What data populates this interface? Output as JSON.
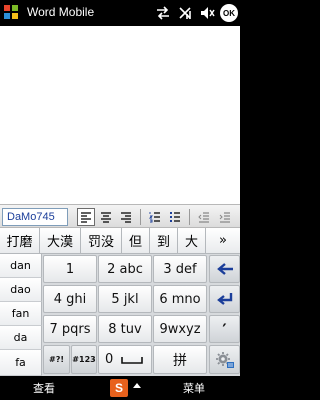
{
  "titlebar": {
    "title": "Word Mobile",
    "status_icons": [
      "connectivity-arrows-icon",
      "no-signal-icon",
      "speaker-muted-icon"
    ],
    "ok_label": "OK"
  },
  "toolbar": {
    "font_name": "DaMo745",
    "buttons": [
      "align-left-icon",
      "align-center-icon",
      "align-right-icon",
      "numbered-list-icon",
      "bulleted-list-icon",
      "decrease-indent-icon",
      "increase-indent-icon"
    ]
  },
  "keyboard": {
    "candidates": [
      "打磨",
      "大漠",
      "罚没",
      "但",
      "到",
      "大"
    ],
    "more_label": "»",
    "pinyin_options": [
      "dan",
      "dao",
      "fan",
      "da",
      "fa"
    ],
    "digit_keys": [
      {
        "label": "1"
      },
      {
        "label": "2 abc"
      },
      {
        "label": "3 def"
      },
      {
        "label": "4 ghi"
      },
      {
        "label": "5 jkl"
      },
      {
        "label": "6 mno"
      },
      {
        "label": "7 pqrs"
      },
      {
        "label": "8 tuv"
      },
      {
        "label": "9wxyz"
      }
    ],
    "symbol_key": "#?!",
    "num_key": "#123",
    "zero_key": "0",
    "pinyin_key": "拼",
    "apostrophe_key": "′"
  },
  "softkeys": {
    "left": "查看",
    "right": "菜单",
    "ime_label": "S"
  },
  "colors": {
    "accent_ime": "#e8611c",
    "arrow_blue": "#1b3e9a"
  }
}
